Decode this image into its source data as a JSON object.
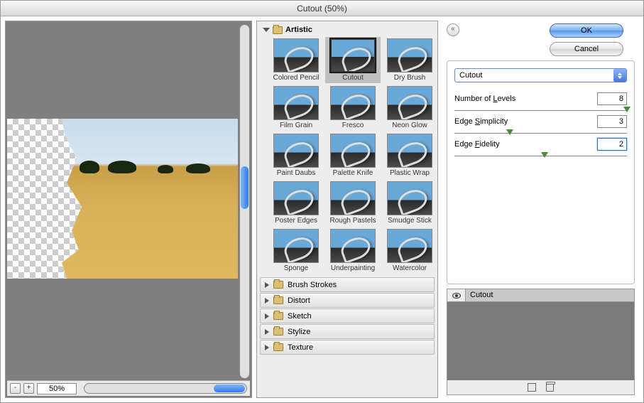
{
  "window": {
    "title": "Cutout (50%)"
  },
  "preview": {
    "zoom": "50%",
    "minus": "-",
    "plus": "+"
  },
  "gallery": {
    "open_category": "Artistic",
    "filters": [
      "Colored Pencil",
      "Cutout",
      "Dry Brush",
      "Film Grain",
      "Fresco",
      "Neon Glow",
      "Paint Daubs",
      "Palette Knife",
      "Plastic Wrap",
      "Poster Edges",
      "Rough Pastels",
      "Smudge Stick",
      "Sponge",
      "Underpainting",
      "Watercolor"
    ],
    "selected": "Cutout",
    "closed_categories": [
      "Brush Strokes",
      "Distort",
      "Sketch",
      "Stylize",
      "Texture"
    ]
  },
  "buttons": {
    "ok": "OK",
    "cancel": "Cancel"
  },
  "settings": {
    "filter_name": "Cutout",
    "params": [
      {
        "label_pre": "Number of ",
        "label_u": "L",
        "label_post": "evels",
        "value": "8",
        "pos": 98
      },
      {
        "label_pre": "Edge ",
        "label_u": "S",
        "label_post": "implicity",
        "value": "3",
        "pos": 30
      },
      {
        "label_pre": "Edge ",
        "label_u": "F",
        "label_post": "idelity",
        "value": "2",
        "pos": 50
      }
    ]
  },
  "layers": {
    "active": "Cutout"
  },
  "collapse_glyph": "«"
}
